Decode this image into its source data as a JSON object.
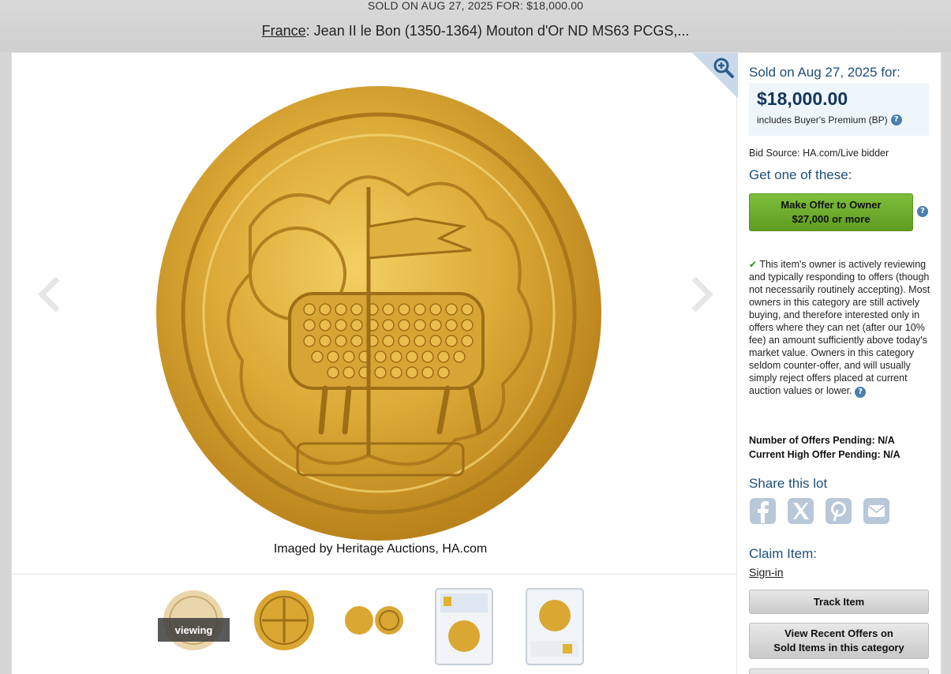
{
  "banner": {
    "sold_line": "SOLD ON AUG 27, 2025 FOR: $18,000.00",
    "title_link": "France",
    "title_rest": ": Jean II le Bon (1350-1364) Mouton d'Or ND MS63 PCGS,..."
  },
  "gallery": {
    "credit": "Imaged by Heritage Auctions, HA.com",
    "viewing_label": "viewing",
    "thumbnail_count": 5
  },
  "sidebar": {
    "sold_heading": "Sold on Aug 27, 2025 for:",
    "price": "$18,000.00",
    "bp_note": "includes Buyer's Premium (BP)",
    "bid_source": "Bid Source: HA.com/Live bidder",
    "get_heading": "Get one of these:",
    "offer_button_line1": "Make Offer to Owner",
    "offer_button_line2": "$27,000 or more",
    "owner_note": "This item's owner is actively reviewing and typically responding to offers (though not necessarily routinely accepting). Most owners in this category are still actively buying, and therefore interested only in offers where they can net (after our 10% fee) an amount sufficiently above today's market value. Owners in this category seldom counter-offer, and will usually simply reject offers placed at current auction values or lower.",
    "offers_pending": "Number of Offers Pending: N/A",
    "high_offer": "Current High Offer Pending: N/A",
    "share_heading": "Share this lot",
    "claim_heading": "Claim Item:",
    "signin": "Sign-in",
    "track_button": "Track Item",
    "recent_button_line1": "View Recent Offers on",
    "recent_button_line2": "Sold Items in this category"
  },
  "colors": {
    "accent_blue": "#1d4f7a",
    "offer_green": "#6aaa2c",
    "gold": "#d9a732"
  },
  "icons": [
    "zoom-in-icon",
    "chevron-left-icon",
    "chevron-right-icon",
    "help-icon",
    "checkmark-icon",
    "facebook-icon",
    "x-icon",
    "pinterest-icon",
    "email-icon"
  ]
}
